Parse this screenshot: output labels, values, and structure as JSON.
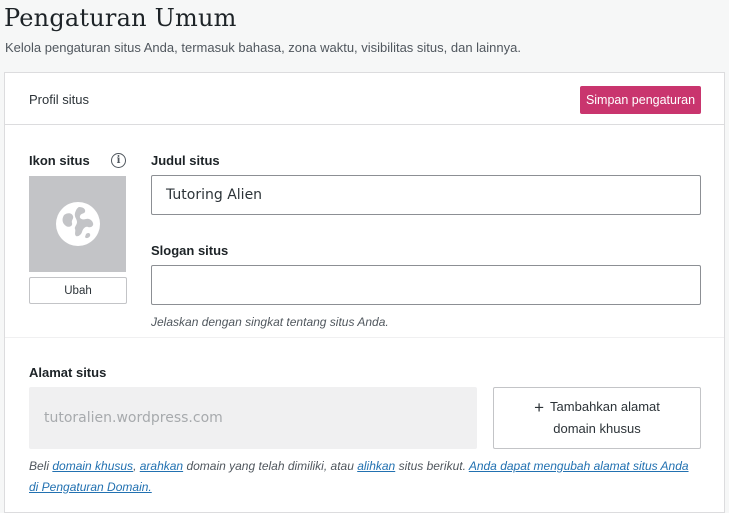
{
  "page": {
    "title": "Pengaturan Umum",
    "subtitle": "Kelola pengaturan situs Anda, termasuk bahasa, zona waktu, visibilitas situs, dan lainnya."
  },
  "card": {
    "header_title": "Profil situs",
    "save_label": "Simpan pengaturan"
  },
  "site_icon": {
    "label": "Ikon situs",
    "info_icon": "info-icon",
    "placeholder_icon": "globe-icon",
    "change_label": "Ubah"
  },
  "site_title": {
    "label": "Judul situs",
    "value": "Tutoring Alien"
  },
  "tagline": {
    "label": "Slogan situs",
    "value": "",
    "hint": "Jelaskan dengan singkat tentang situs Anda."
  },
  "address": {
    "label": "Alamat situs",
    "value": "tutoralien.wordpress.com",
    "add_domain_line1": "Tambahkan alamat",
    "add_domain_line2": "domain khusus",
    "add_icon": "plus-icon"
  },
  "note": {
    "t1": "Beli ",
    "link_buy": "domain khusus",
    "t2": ", ",
    "link_map": "arahkan",
    "t3": " domain yang telah dimiliki, atau ",
    "link_redirect": "alihkan",
    "t4": " situs berikut. ",
    "link_change": "Anda dapat mengubah alamat situs Anda di Pengaturan Domain."
  },
  "colors": {
    "accent": "#c9356e",
    "link": "#2271b1",
    "icon_placeholder_bg": "#c3c4c7"
  }
}
